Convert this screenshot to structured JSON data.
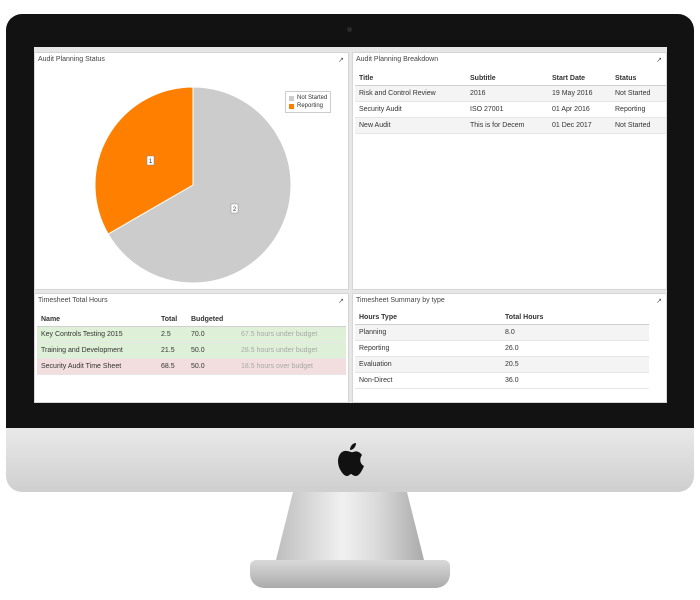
{
  "colors": {
    "not_started": "#cccccc",
    "reporting": "#ff8000"
  },
  "status_panel": {
    "title": "Audit Planning Status",
    "legend": [
      {
        "label": "Not Started"
      },
      {
        "label": "Reporting"
      }
    ],
    "slice_labels": {
      "not_started": "2",
      "reporting": "1"
    }
  },
  "chart_data": {
    "type": "pie",
    "title": "Audit Planning Status",
    "categories": [
      "Not Started",
      "Reporting"
    ],
    "values": [
      2,
      1
    ],
    "legend": "top-right"
  },
  "breakdown_panel": {
    "title": "Audit Planning Breakdown",
    "headers": {
      "title": "Title",
      "subtitle": "Subtitle",
      "start": "Start Date",
      "status": "Status"
    },
    "rows": [
      {
        "title": "Risk and Control Review",
        "subtitle": "2016",
        "start": "19 May 2016",
        "status": "Not Started"
      },
      {
        "title": "Security Audit",
        "subtitle": "ISO 27001",
        "start": "01 Apr 2016",
        "status": "Reporting"
      },
      {
        "title": "New Audit",
        "subtitle": "This is for Decem",
        "start": "01 Dec 2017",
        "status": "Not Started"
      }
    ]
  },
  "timesheet_panel": {
    "title": "Timesheet Total Hours",
    "headers": {
      "name": "Name",
      "total": "Total",
      "budgeted": "Budgeted"
    },
    "rows": [
      {
        "name": "Key Controls Testing 2015",
        "total": "2.5",
        "budgeted": "70.0",
        "note": "67.5 hours under budget"
      },
      {
        "name": "Training and Development",
        "total": "21.5",
        "budgeted": "50.0",
        "note": "28.5 hours under budget"
      },
      {
        "name": "Security Audit Time Sheet",
        "total": "68.5",
        "budgeted": "50.0",
        "note": "18.5 hours over budget"
      }
    ]
  },
  "summary_panel": {
    "title": "Timesheet Summary by type",
    "headers": {
      "type": "Hours Type",
      "hours": "Total Hours"
    },
    "rows": [
      {
        "type": "Planning",
        "hours": "8.0"
      },
      {
        "type": "Reporting",
        "hours": "26.0"
      },
      {
        "type": "Evaluation",
        "hours": "20.5"
      },
      {
        "type": "Non-Direct",
        "hours": "36.0"
      }
    ]
  }
}
